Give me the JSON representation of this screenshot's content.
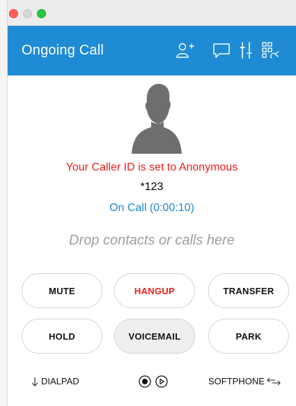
{
  "header": {
    "title": "Ongoing Call"
  },
  "call": {
    "caller_id_notice": "Your Caller ID is set to Anonymous",
    "number": "*123",
    "status": "On Call (0:00:10)"
  },
  "drop_zone": {
    "placeholder": "Drop contacts or calls here"
  },
  "buttons": {
    "mute": "MUTE",
    "hangup": "HANGUP",
    "transfer": "TRANSFER",
    "hold": "HOLD",
    "voicemail": "VOICEMAIL",
    "park": "PARK"
  },
  "footer": {
    "dialpad": "DIALPAD",
    "softphone": "SOFTPHONE"
  },
  "icons": [
    "add-contact-icon",
    "chat-icon",
    "audio-settings-icon",
    "dialpad-grid-icon",
    "record-icon",
    "play-icon",
    "arrow-down-icon",
    "swap-icon"
  ],
  "colors": {
    "accent": "#1e8bd4",
    "danger": "#ee1c1c",
    "status": "#1e86d0"
  }
}
